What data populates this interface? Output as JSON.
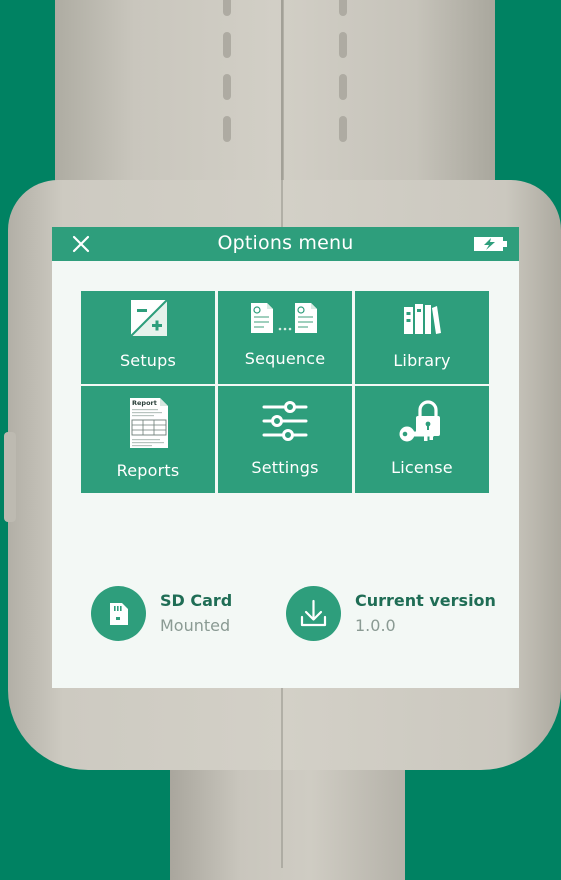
{
  "header": {
    "title": "Options menu",
    "close_icon": "close-icon",
    "battery_icon": "battery-charging-icon"
  },
  "menu": {
    "tiles": [
      {
        "label": "Setups",
        "icon": "setups-icon"
      },
      {
        "label": "Sequence",
        "icon": "sequence-icon"
      },
      {
        "label": "Library",
        "icon": "library-icon"
      },
      {
        "label": "Reports",
        "icon": "report-document-icon",
        "icon_text": "Report"
      },
      {
        "label": "Settings",
        "icon": "sliders-icon"
      },
      {
        "label": "License",
        "icon": "lock-key-icon"
      }
    ]
  },
  "status": {
    "sd_card": {
      "name": "SD Card",
      "value": "Mounted",
      "icon": "sd-card-icon"
    },
    "version": {
      "name": "Current version",
      "value": "1.0.0",
      "icon": "download-icon"
    }
  },
  "colors": {
    "background": "#008262",
    "accent": "#2e9e7c",
    "screen": "#f3f8f5",
    "status_name": "#1f6d55",
    "status_value": "#8a9a93"
  }
}
